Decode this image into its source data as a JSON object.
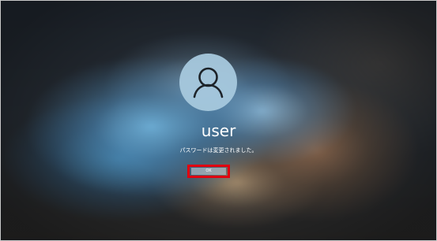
{
  "login": {
    "user_name": "user",
    "message": "パスワードは変更されました。",
    "ok_label": "OK"
  },
  "colors": {
    "highlight": "#e00010",
    "avatar_bg": "#a7c9de"
  },
  "icons": {
    "avatar": "user-silhouette-icon"
  }
}
